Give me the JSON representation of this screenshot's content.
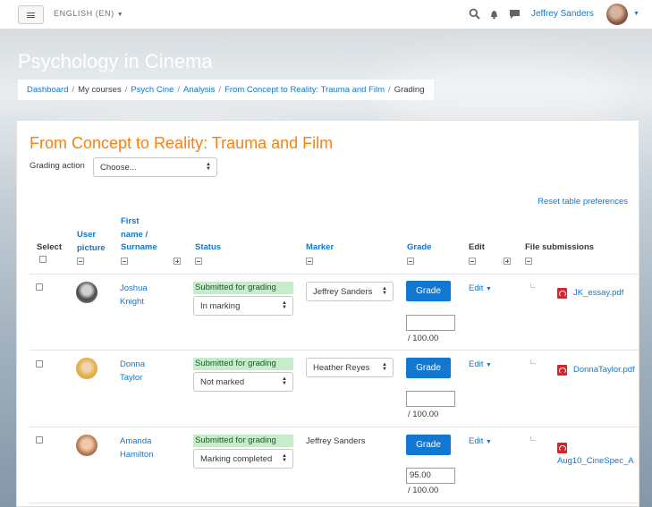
{
  "navbar": {
    "language": "ENGLISH (EN)",
    "user_name": "Jeffrey Sanders",
    "icons": [
      "search-icon",
      "notifications-icon",
      "messages-icon"
    ]
  },
  "header": {
    "course_title": "Psychology in Cinema",
    "breadcrumb": [
      "Dashboard",
      "My courses",
      "Psych Cine",
      "Analysis",
      "From Concept to Reality: Trauma and Film",
      "Grading"
    ]
  },
  "main": {
    "heading": "From Concept to Reality: Trauma and Film",
    "grading_action_label": "Grading action",
    "grading_action_value": "Choose...",
    "reset_link": "Reset table preferences",
    "columns": {
      "select": "Select",
      "user_picture": [
        "User",
        "picture"
      ],
      "name": [
        "First",
        "name /",
        "Surname"
      ],
      "status": "Status",
      "marker": "Marker",
      "grade": "Grade",
      "edit": "Edit",
      "files": "File submissions"
    },
    "grade_button_label": "Grade",
    "edit_label": "Edit",
    "rows": [
      {
        "first": "Joshua",
        "last": "Knight",
        "status": "Submitted for grading",
        "workflow": "In marking",
        "marker": "Jeffrey Sanders",
        "marker_is_select": true,
        "grade_value": "",
        "out_of": "/ 100.00",
        "file": "JK_essay.pdf"
      },
      {
        "first": "Donna",
        "last": "Taylor",
        "status": "Submitted for grading",
        "workflow": "Not marked",
        "marker": "Heather Reyes",
        "marker_is_select": true,
        "grade_value": "",
        "out_of": "/ 100.00",
        "file": "DonnaTaylor.pdf"
      },
      {
        "first": "Amanda",
        "last": "Hamilton",
        "status": "Submitted for grading",
        "workflow": "Marking completed",
        "marker": "Jeffrey Sanders",
        "marker_is_select": false,
        "grade_value": "95.00",
        "out_of": "/ 100.00",
        "file": "Aug10_CineSpec_A"
      }
    ]
  },
  "colors": {
    "accent": "#1177d1",
    "heading": "#f98012",
    "status_submitted": "#c6eccb"
  }
}
